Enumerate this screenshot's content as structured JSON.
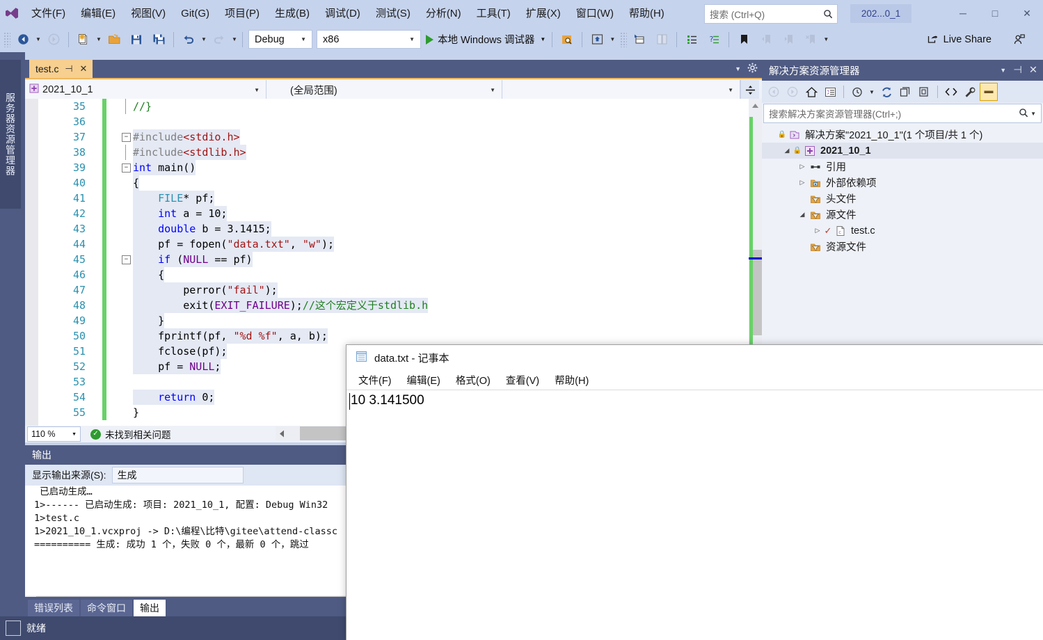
{
  "titlebar": {
    "menu": [
      "文件(F)",
      "编辑(E)",
      "视图(V)",
      "Git(G)",
      "项目(P)",
      "生成(B)",
      "调试(D)",
      "测试(S)",
      "分析(N)",
      "工具(T)",
      "扩展(X)",
      "窗口(W)",
      "帮助(H)"
    ],
    "search_placeholder": "搜索 (Ctrl+Q)",
    "session_badge": "202...0_1",
    "minimize": "─",
    "maximize": "□",
    "close": "✕"
  },
  "toolbar": {
    "configuration": "Debug",
    "platform": "x86",
    "run_label": "本地 Windows 调试器",
    "live_share": "Live Share"
  },
  "left_rail": {
    "server_explorer": "服务器资源管理器"
  },
  "editor": {
    "tab_name": "test.c",
    "nav_project": "2021_10_1",
    "nav_scope": "(全局范围)",
    "nav_member": "",
    "zoom": "110 %",
    "issues": "未找到相关问题",
    "lines": [
      {
        "num": "35",
        "text": "//}",
        "fold": "end",
        "marked": true,
        "sel": false,
        "spans": [
          {
            "c": "cm",
            "t": "//}"
          }
        ]
      },
      {
        "num": "36",
        "text": "",
        "fold": "",
        "marked": true,
        "sel": false,
        "spans": []
      },
      {
        "num": "37",
        "text": "#include<stdio.h>",
        "fold": "minus",
        "marked": true,
        "sel": true,
        "spans": [
          {
            "c": "pp",
            "t": "#include"
          },
          {
            "c": "ppk",
            "t": "<stdio.h>"
          }
        ]
      },
      {
        "num": "38",
        "text": "#include<stdlib.h>",
        "fold": "bar",
        "marked": true,
        "sel": true,
        "spans": [
          {
            "c": "pp",
            "t": "#include"
          },
          {
            "c": "ppk",
            "t": "<stdlib.h>"
          }
        ]
      },
      {
        "num": "39",
        "text": "int main()",
        "fold": "minus",
        "marked": true,
        "sel": true,
        "spans": [
          {
            "c": "k",
            "t": "int"
          },
          {
            "c": "n",
            "t": " main()"
          }
        ]
      },
      {
        "num": "40",
        "text": "{",
        "fold": "",
        "marked": true,
        "sel": true,
        "spans": [
          {
            "c": "n",
            "t": "{"
          }
        ]
      },
      {
        "num": "41",
        "text": "    FILE* pf;",
        "fold": "",
        "marked": true,
        "sel": true,
        "spans": [
          {
            "c": "n",
            "t": "    "
          },
          {
            "c": "t",
            "t": "FILE"
          },
          {
            "c": "n",
            "t": "* pf;"
          }
        ]
      },
      {
        "num": "42",
        "text": "    int a = 10;",
        "fold": "",
        "marked": true,
        "sel": true,
        "spans": [
          {
            "c": "n",
            "t": "    "
          },
          {
            "c": "k",
            "t": "int"
          },
          {
            "c": "n",
            "t": " a = 10;"
          }
        ]
      },
      {
        "num": "43",
        "text": "    double b = 3.1415;",
        "fold": "",
        "marked": true,
        "sel": true,
        "spans": [
          {
            "c": "n",
            "t": "    "
          },
          {
            "c": "k",
            "t": "double"
          },
          {
            "c": "n",
            "t": " b = 3.1415;"
          }
        ]
      },
      {
        "num": "44",
        "text": "    pf = fopen(\"data.txt\", \"w\");",
        "fold": "",
        "marked": true,
        "sel": true,
        "spans": [
          {
            "c": "n",
            "t": "    pf = fopen("
          },
          {
            "c": "s",
            "t": "\"data.txt\""
          },
          {
            "c": "n",
            "t": ", "
          },
          {
            "c": "s",
            "t": "\"w\""
          },
          {
            "c": "n",
            "t": ");"
          }
        ]
      },
      {
        "num": "45",
        "text": "    if (NULL == pf)",
        "fold": "minus",
        "marked": true,
        "sel": true,
        "spans": [
          {
            "c": "n",
            "t": "    "
          },
          {
            "c": "k",
            "t": "if"
          },
          {
            "c": "n",
            "t": " ("
          },
          {
            "c": "m",
            "t": "NULL"
          },
          {
            "c": "n",
            "t": " == pf)"
          }
        ]
      },
      {
        "num": "46",
        "text": "    {",
        "fold": "",
        "marked": true,
        "sel": true,
        "spans": [
          {
            "c": "n",
            "t": "    {"
          }
        ]
      },
      {
        "num": "47",
        "text": "        perror(\"fail\");",
        "fold": "",
        "marked": true,
        "sel": true,
        "spans": [
          {
            "c": "n",
            "t": "        perror("
          },
          {
            "c": "s",
            "t": "\"fail\""
          },
          {
            "c": "n",
            "t": ");"
          }
        ]
      },
      {
        "num": "48",
        "text": "        exit(EXIT_FAILURE);//这个宏定义于stdlib.h",
        "fold": "",
        "marked": true,
        "sel": true,
        "spans": [
          {
            "c": "n",
            "t": "        exit("
          },
          {
            "c": "m",
            "t": "EXIT_FAILURE"
          },
          {
            "c": "n",
            "t": ");"
          },
          {
            "c": "cm",
            "t": "//这个宏定义于stdlib.h"
          }
        ]
      },
      {
        "num": "49",
        "text": "    }",
        "fold": "",
        "marked": true,
        "sel": true,
        "spans": [
          {
            "c": "n",
            "t": "    }"
          }
        ]
      },
      {
        "num": "50",
        "text": "    fprintf(pf, \"%d %f\", a, b);",
        "fold": "",
        "marked": true,
        "sel": true,
        "spans": [
          {
            "c": "n",
            "t": "    fprintf(pf, "
          },
          {
            "c": "s",
            "t": "\"%d %f\""
          },
          {
            "c": "n",
            "t": ", a, b);"
          }
        ]
      },
      {
        "num": "51",
        "text": "    fclose(pf);",
        "fold": "",
        "marked": true,
        "sel": true,
        "spans": [
          {
            "c": "n",
            "t": "    fclose(pf);"
          }
        ]
      },
      {
        "num": "52",
        "text": "    pf = NULL;",
        "fold": "",
        "marked": true,
        "sel": true,
        "spans": [
          {
            "c": "n",
            "t": "    pf = "
          },
          {
            "c": "m",
            "t": "NULL"
          },
          {
            "c": "n",
            "t": ";"
          }
        ]
      },
      {
        "num": "53",
        "text": "",
        "fold": "",
        "marked": true,
        "sel": true,
        "spans": []
      },
      {
        "num": "54",
        "text": "    return 0;",
        "fold": "",
        "marked": true,
        "sel": true,
        "spans": [
          {
            "c": "n",
            "t": "    "
          },
          {
            "c": "k",
            "t": "return"
          },
          {
            "c": "n",
            "t": " 0;"
          }
        ]
      },
      {
        "num": "55",
        "text": "}",
        "fold": "",
        "marked": true,
        "sel": false,
        "spans": [
          {
            "c": "n",
            "t": "}"
          }
        ]
      }
    ]
  },
  "output": {
    "title": "输出",
    "source_label": "显示输出来源(S):",
    "source_value": "生成",
    "lines": [
      " 已启动生成…",
      "1>------ 已启动生成: 项目: 2021_10_1, 配置: Debug Win32",
      "1>test.c",
      "1>2021_10_1.vcxproj -> D:\\编程\\比特\\gitee\\attend-classc",
      "========== 生成: 成功 1 个，失败 0 个，最新 0 个，跳过 "
    ],
    "tabs": [
      {
        "label": "错误列表",
        "active": false
      },
      {
        "label": "命令窗口",
        "active": false
      },
      {
        "label": "输出",
        "active": true
      }
    ]
  },
  "solution_explorer": {
    "title": "解决方案资源管理器",
    "search_placeholder": "搜索解决方案资源管理器(Ctrl+;)",
    "tree": [
      {
        "label": "解决方案\"2021_10_1\"(1 个项目/共 1 个)",
        "indent": 0,
        "expander": "",
        "icon": "solution-icon",
        "bold": false,
        "selected": false,
        "check": false
      },
      {
        "label": "2021_10_1",
        "indent": 1,
        "expander": "◢",
        "icon": "project-icon",
        "bold": true,
        "selected": true,
        "check": false
      },
      {
        "label": "引用",
        "indent": 2,
        "expander": "▷",
        "icon": "references-icon",
        "bold": false,
        "selected": false,
        "check": false
      },
      {
        "label": "外部依赖项",
        "indent": 2,
        "expander": "▷",
        "icon": "external-deps-icon",
        "bold": false,
        "selected": false,
        "check": false
      },
      {
        "label": "头文件",
        "indent": 2,
        "expander": "",
        "icon": "filter-folder-icon",
        "bold": false,
        "selected": false,
        "check": false
      },
      {
        "label": "源文件",
        "indent": 2,
        "expander": "◢",
        "icon": "filter-folder-icon",
        "bold": false,
        "selected": false,
        "check": false
      },
      {
        "label": "test.c",
        "indent": 3,
        "expander": "▷",
        "icon": "c-file-icon",
        "bold": false,
        "selected": false,
        "check": true
      },
      {
        "label": "资源文件",
        "indent": 2,
        "expander": "",
        "icon": "filter-folder-icon",
        "bold": false,
        "selected": false,
        "check": false
      }
    ]
  },
  "statusbar": {
    "text": "就绪"
  },
  "notepad": {
    "title": "data.txt - 记事本",
    "menu": [
      "文件(F)",
      "编辑(E)",
      "格式(O)",
      "查看(V)",
      "帮助(H)"
    ],
    "content": "10 3.141500"
  },
  "colors": {
    "chrome": "#c6d3ec",
    "dock": "#4f5b83",
    "status": "#3f4a6e",
    "tab_active": "#f7cf8f",
    "accent_orange": "#f0b860",
    "change_bar": "#68d168",
    "selection": "#e4e9f4",
    "keyword": "#0000ff",
    "string": "#a31515",
    "comment": "#1f7f1f",
    "macro": "#6f008a",
    "type": "#2b91af"
  }
}
